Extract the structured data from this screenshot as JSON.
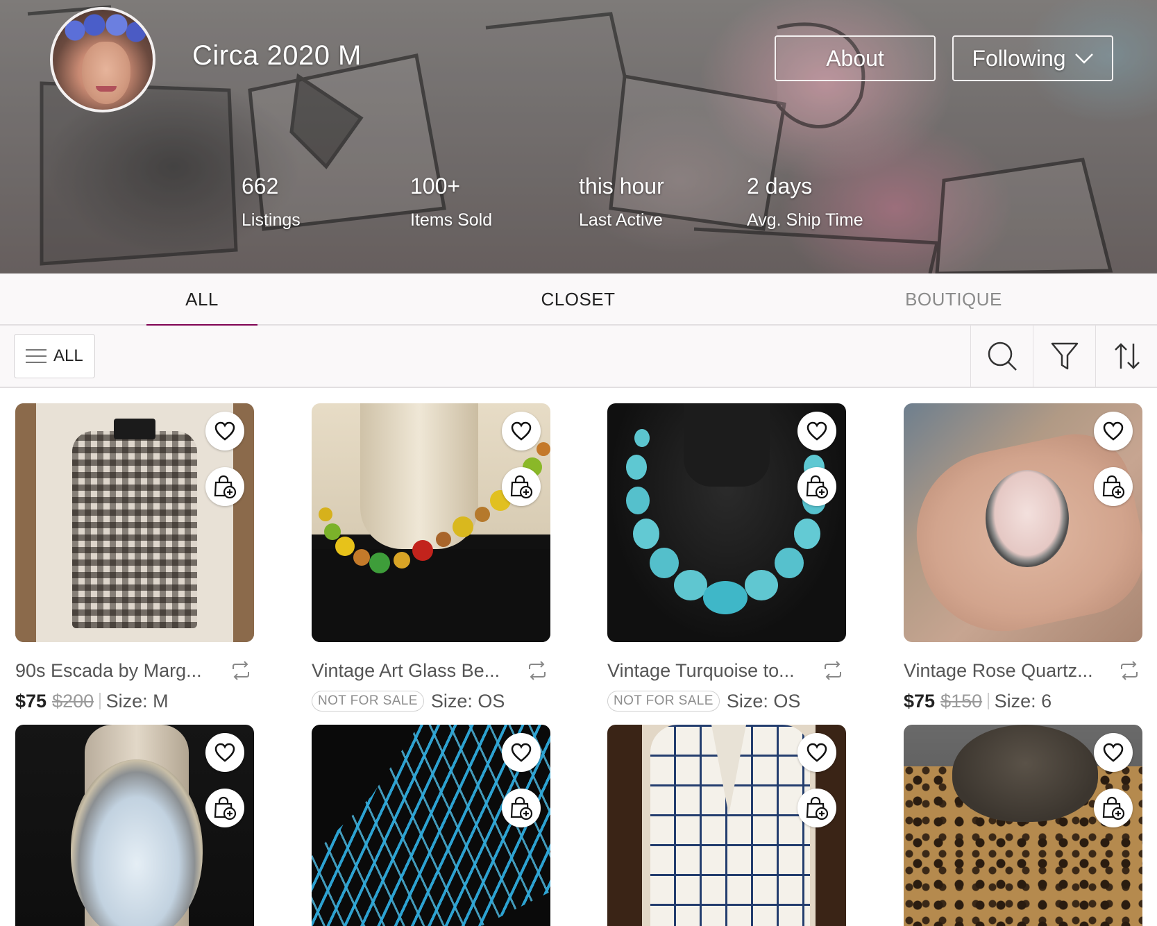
{
  "header": {
    "shop_name": "Circa 2020 M",
    "about_label": "About",
    "following_label": "Following",
    "stats": [
      {
        "value": "662",
        "label": "Listings"
      },
      {
        "value": "100+",
        "label": "Items Sold"
      },
      {
        "value": "this hour",
        "label": "Last Active"
      },
      {
        "value": "2 days",
        "label": "Avg. Ship Time"
      }
    ]
  },
  "tabs": [
    {
      "label": "ALL",
      "active": true
    },
    {
      "label": "CLOSET",
      "active": false
    },
    {
      "label": "BOUTIQUE",
      "active": false
    }
  ],
  "toolbar": {
    "category_label": "ALL",
    "icons": [
      "search-icon",
      "filter-icon",
      "sort-icon"
    ]
  },
  "listings": [
    {
      "title": "90s Escada by Marg...",
      "price": "$75",
      "original_price": "$200",
      "size": "Size: M",
      "status": ""
    },
    {
      "title": "Vintage Art Glass Be...",
      "price": "",
      "original_price": "",
      "size": "Size: OS",
      "status": "NOT FOR SALE"
    },
    {
      "title": "Vintage Turquoise to...",
      "price": "",
      "original_price": "",
      "size": "Size: OS",
      "status": "NOT FOR SALE"
    },
    {
      "title": "Vintage Rose Quartz...",
      "price": "$75",
      "original_price": "$150",
      "size": "Size: 6",
      "status": ""
    },
    {
      "title": "",
      "price": "",
      "original_price": "",
      "size": "",
      "status": ""
    },
    {
      "title": "",
      "price": "",
      "original_price": "",
      "size": "",
      "status": ""
    },
    {
      "title": "",
      "price": "",
      "original_price": "",
      "size": "",
      "status": ""
    },
    {
      "title": "",
      "price": "",
      "original_price": "",
      "size": "",
      "status": ""
    }
  ],
  "colors": {
    "accent": "#7f0353",
    "tab_inactive": "#8b8b8b",
    "background": "#faf8f9"
  }
}
